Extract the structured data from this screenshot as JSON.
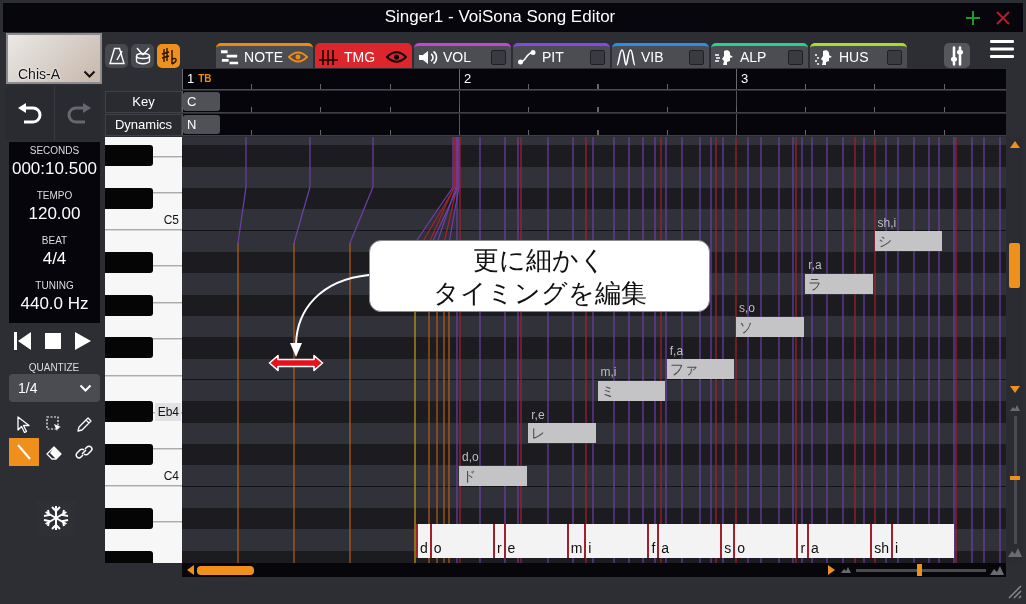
{
  "window": {
    "title": "Singer1 - VoiSona Song Editor"
  },
  "voice": {
    "name": "Chis-A"
  },
  "toggles": [
    {
      "on": false
    },
    {
      "on": false
    },
    {
      "on": true
    }
  ],
  "tabs": [
    {
      "label": "NOTE",
      "color": "#f08a0c",
      "selected": false,
      "shown": true
    },
    {
      "label": "TMG",
      "color": "#dc262c",
      "selected": true,
      "shown": true
    },
    {
      "label": "VOL",
      "color": "#c446d6",
      "selected": false,
      "shown": false
    },
    {
      "label": "PIT",
      "color": "#8646ee",
      "selected": false,
      "shown": false
    },
    {
      "label": "VIB",
      "color": "#2a8ee8",
      "selected": false,
      "shown": false
    },
    {
      "label": "ALP",
      "color": "#22d48e",
      "selected": false,
      "shown": false
    },
    {
      "label": "HUS",
      "color": "#a6de2a",
      "selected": false,
      "shown": false
    }
  ],
  "undo": {
    "disabled": false
  },
  "redo": {
    "disabled": true
  },
  "info": [
    {
      "label": "SECONDS",
      "value": "000:10.500"
    },
    {
      "label": "TEMPO",
      "value": "120.00"
    },
    {
      "label": "BEAT",
      "value": "4/4"
    },
    {
      "label": "TUNING",
      "value": "440.0 Hz"
    }
  ],
  "quantize": {
    "label": "QUANTIZE",
    "value": "1/4"
  },
  "tools": [
    {
      "selected": false
    },
    {
      "selected": false
    },
    {
      "selected": false
    },
    {
      "selected": true
    },
    {
      "selected": false
    },
    {
      "selected": false
    }
  ],
  "ruler": {
    "measures": [
      {
        "number": "1",
        "marker": "TB"
      },
      {
        "number": "2"
      },
      {
        "number": "3"
      }
    ]
  },
  "parameter_rows": [
    {
      "label": "Key",
      "value": "C"
    },
    {
      "label": "Dynamics",
      "value": "N"
    }
  ],
  "piano_roll": {
    "lanes": [
      {
        "kind": "white"
      },
      {
        "kind": "black"
      },
      {
        "kind": "white"
      },
      {
        "kind": "black"
      },
      {
        "kind": "white",
        "label": {
          "text": "C5",
          "highlighted": false
        }
      },
      {
        "kind": "white",
        "note": {
          "lyric": "シ",
          "phonemes": "sh,i"
        }
      },
      {
        "kind": "black"
      },
      {
        "kind": "white",
        "note": {
          "lyric": "ラ",
          "phonemes": "r,a"
        }
      },
      {
        "kind": "black"
      },
      {
        "kind": "white",
        "note": {
          "lyric": "ソ",
          "phonemes": "s,o"
        }
      },
      {
        "kind": "black"
      },
      {
        "kind": "white",
        "note": {
          "lyric": "ファ",
          "phonemes": "f,a"
        }
      },
      {
        "kind": "white",
        "note": {
          "lyric": "ミ",
          "phonemes": "m,i"
        }
      },
      {
        "kind": "black",
        "label": {
          "text": "Eb4",
          "highlighted": true
        }
      },
      {
        "kind": "white",
        "note": {
          "lyric": "レ",
          "phonemes": "r,e"
        }
      },
      {
        "kind": "black"
      },
      {
        "kind": "white",
        "label": {
          "text": "C4",
          "highlighted": false
        },
        "note": {
          "lyric": "ド",
          "phonemes": "d,o"
        }
      },
      {
        "kind": "white"
      },
      {
        "kind": "black"
      },
      {
        "kind": "white"
      },
      {
        "kind": "black"
      }
    ],
    "phoneme_track": [
      {
        "text": "d",
        "kind": "consonant"
      },
      {
        "text": "o",
        "kind": "vowel"
      },
      {
        "text": "r",
        "kind": "consonant"
      },
      {
        "text": "e",
        "kind": "vowel"
      },
      {
        "text": "m",
        "kind": "consonant"
      },
      {
        "text": "i",
        "kind": "vowel"
      },
      {
        "text": "f",
        "kind": "consonant"
      },
      {
        "text": "a",
        "kind": "vowel"
      },
      {
        "text": "s",
        "kind": "consonant"
      },
      {
        "text": "o",
        "kind": "vowel"
      },
      {
        "text": "r",
        "kind": "consonant"
      },
      {
        "text": "a",
        "kind": "vowel"
      },
      {
        "text": "sh",
        "kind": "consonant"
      },
      {
        "text": "i",
        "kind": "vowel"
      }
    ],
    "callout": {
      "lines": [
        "更に細かく",
        "タイミングを編集"
      ]
    }
  },
  "zoom": {
    "horizontal": {
      "level": 0.49
    },
    "vertical": {
      "level": 0.52
    }
  }
}
